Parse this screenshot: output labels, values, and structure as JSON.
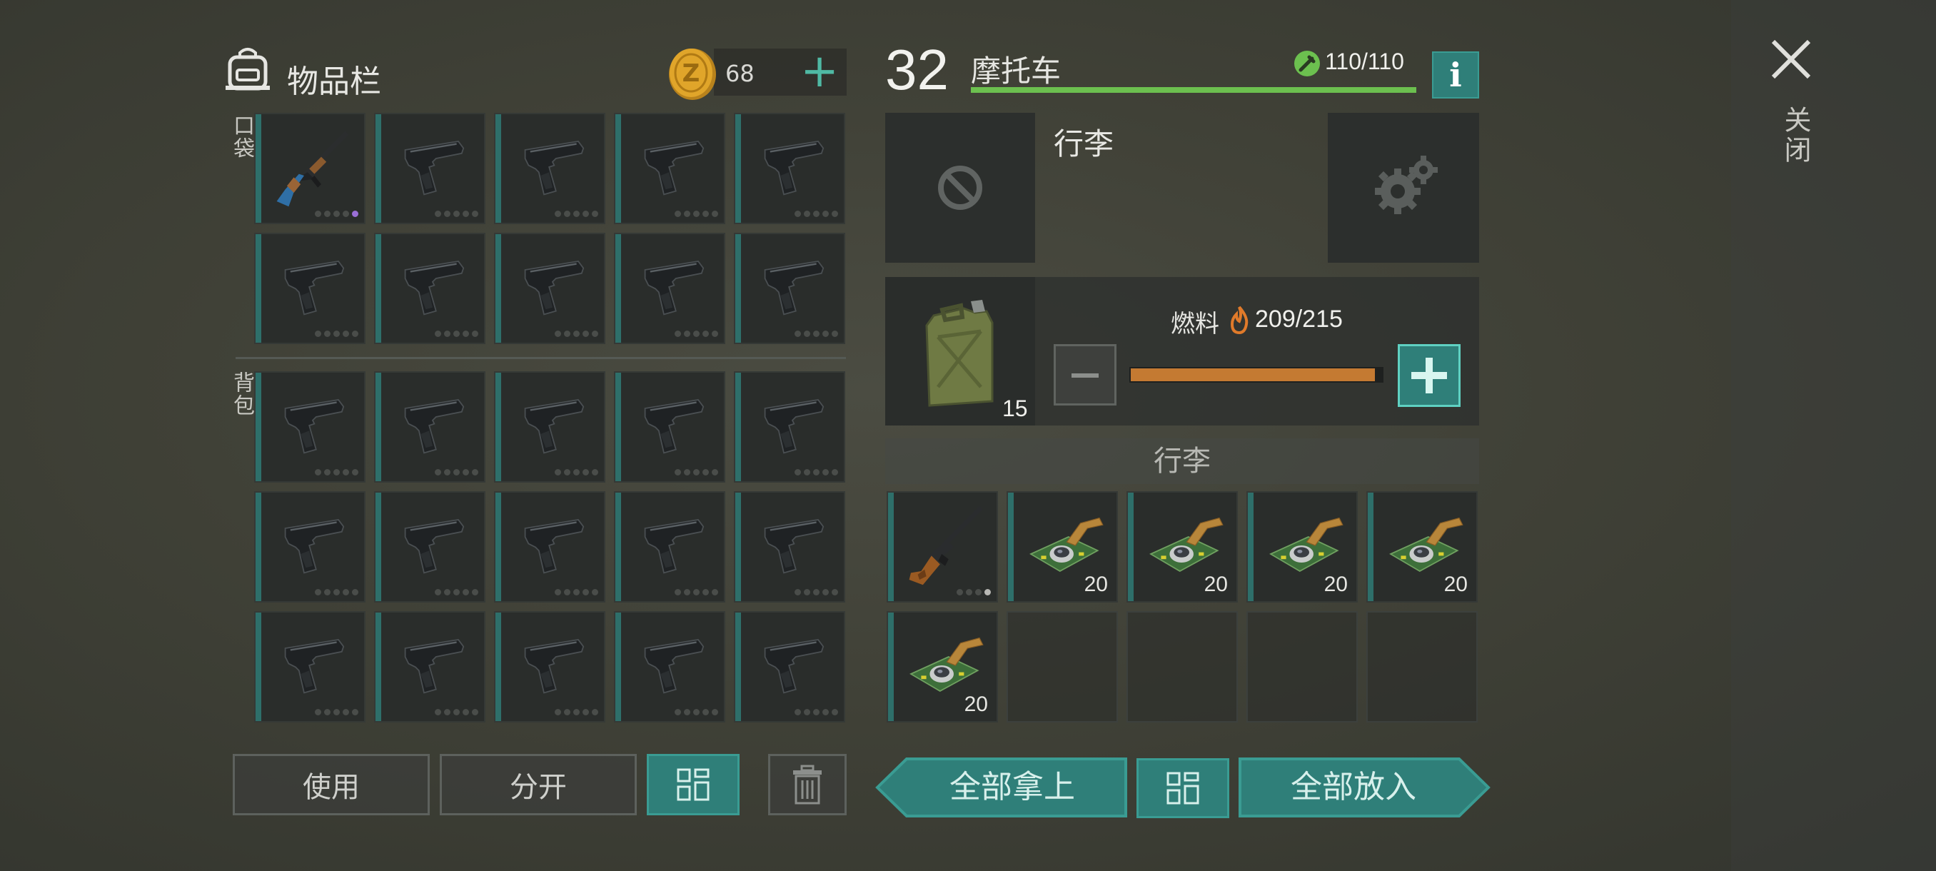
{
  "inventory": {
    "title": "物品栏",
    "coins": "68",
    "pocket_label": "口袋",
    "backpack_label": "背包",
    "pocket_slots": [
      {
        "item": "ak-rifle",
        "dots": 5,
        "active_dot": 4,
        "dot_color": "#9a6fd6"
      },
      {
        "item": "pistol"
      },
      {
        "item": "pistol"
      },
      {
        "item": "pistol"
      },
      {
        "item": "pistol"
      },
      {
        "item": "pistol"
      },
      {
        "item": "pistol"
      },
      {
        "item": "pistol"
      },
      {
        "item": "pistol"
      },
      {
        "item": "pistol"
      }
    ],
    "backpack_slots": [
      {
        "item": "pistol"
      },
      {
        "item": "pistol"
      },
      {
        "item": "pistol"
      },
      {
        "item": "pistol"
      },
      {
        "item": "pistol"
      },
      {
        "item": "pistol"
      },
      {
        "item": "pistol"
      },
      {
        "item": "pistol"
      },
      {
        "item": "pistol"
      },
      {
        "item": "pistol"
      },
      {
        "item": "pistol"
      },
      {
        "item": "pistol"
      },
      {
        "item": "pistol"
      },
      {
        "item": "pistol"
      },
      {
        "item": "pistol"
      }
    ],
    "buttons": {
      "use": "使用",
      "split": "分开",
      "sort_icon": "grid-sort-icon",
      "trash_icon": "trash-icon"
    }
  },
  "vehicle": {
    "level": "32",
    "name": "摩托车",
    "durability": "110/110",
    "durability_fraction": 1.0,
    "info_label": "i",
    "luggage_title": "行李",
    "fuel_label": "燃料",
    "fuel_value": "209/215",
    "fuel_fraction": 0.972,
    "fuel_item_count": "15",
    "luggage_header": "行李",
    "luggage_slots": [
      {
        "item": "rifle",
        "dots": 4,
        "active_dot": 3,
        "dot_color": "#b8b8b4"
      },
      {
        "item": "camera-module",
        "count": "20"
      },
      {
        "item": "camera-module",
        "count": "20"
      },
      {
        "item": "camera-module",
        "count": "20"
      },
      {
        "item": "camera-module",
        "count": "20"
      },
      {
        "item": "camera-module",
        "count": "20"
      },
      {
        "item": "empty"
      },
      {
        "item": "empty"
      },
      {
        "item": "empty"
      },
      {
        "item": "empty"
      }
    ],
    "buttons": {
      "take_all": "全部拿上",
      "put_all": "全部放入",
      "sort_icon": "grid-sort-icon"
    }
  },
  "close_label": "关闭",
  "colors": {
    "accent": "#2f7f79",
    "durability": "#6cc04f",
    "fuel": "#c47a32",
    "coin": "#e0a52a"
  }
}
